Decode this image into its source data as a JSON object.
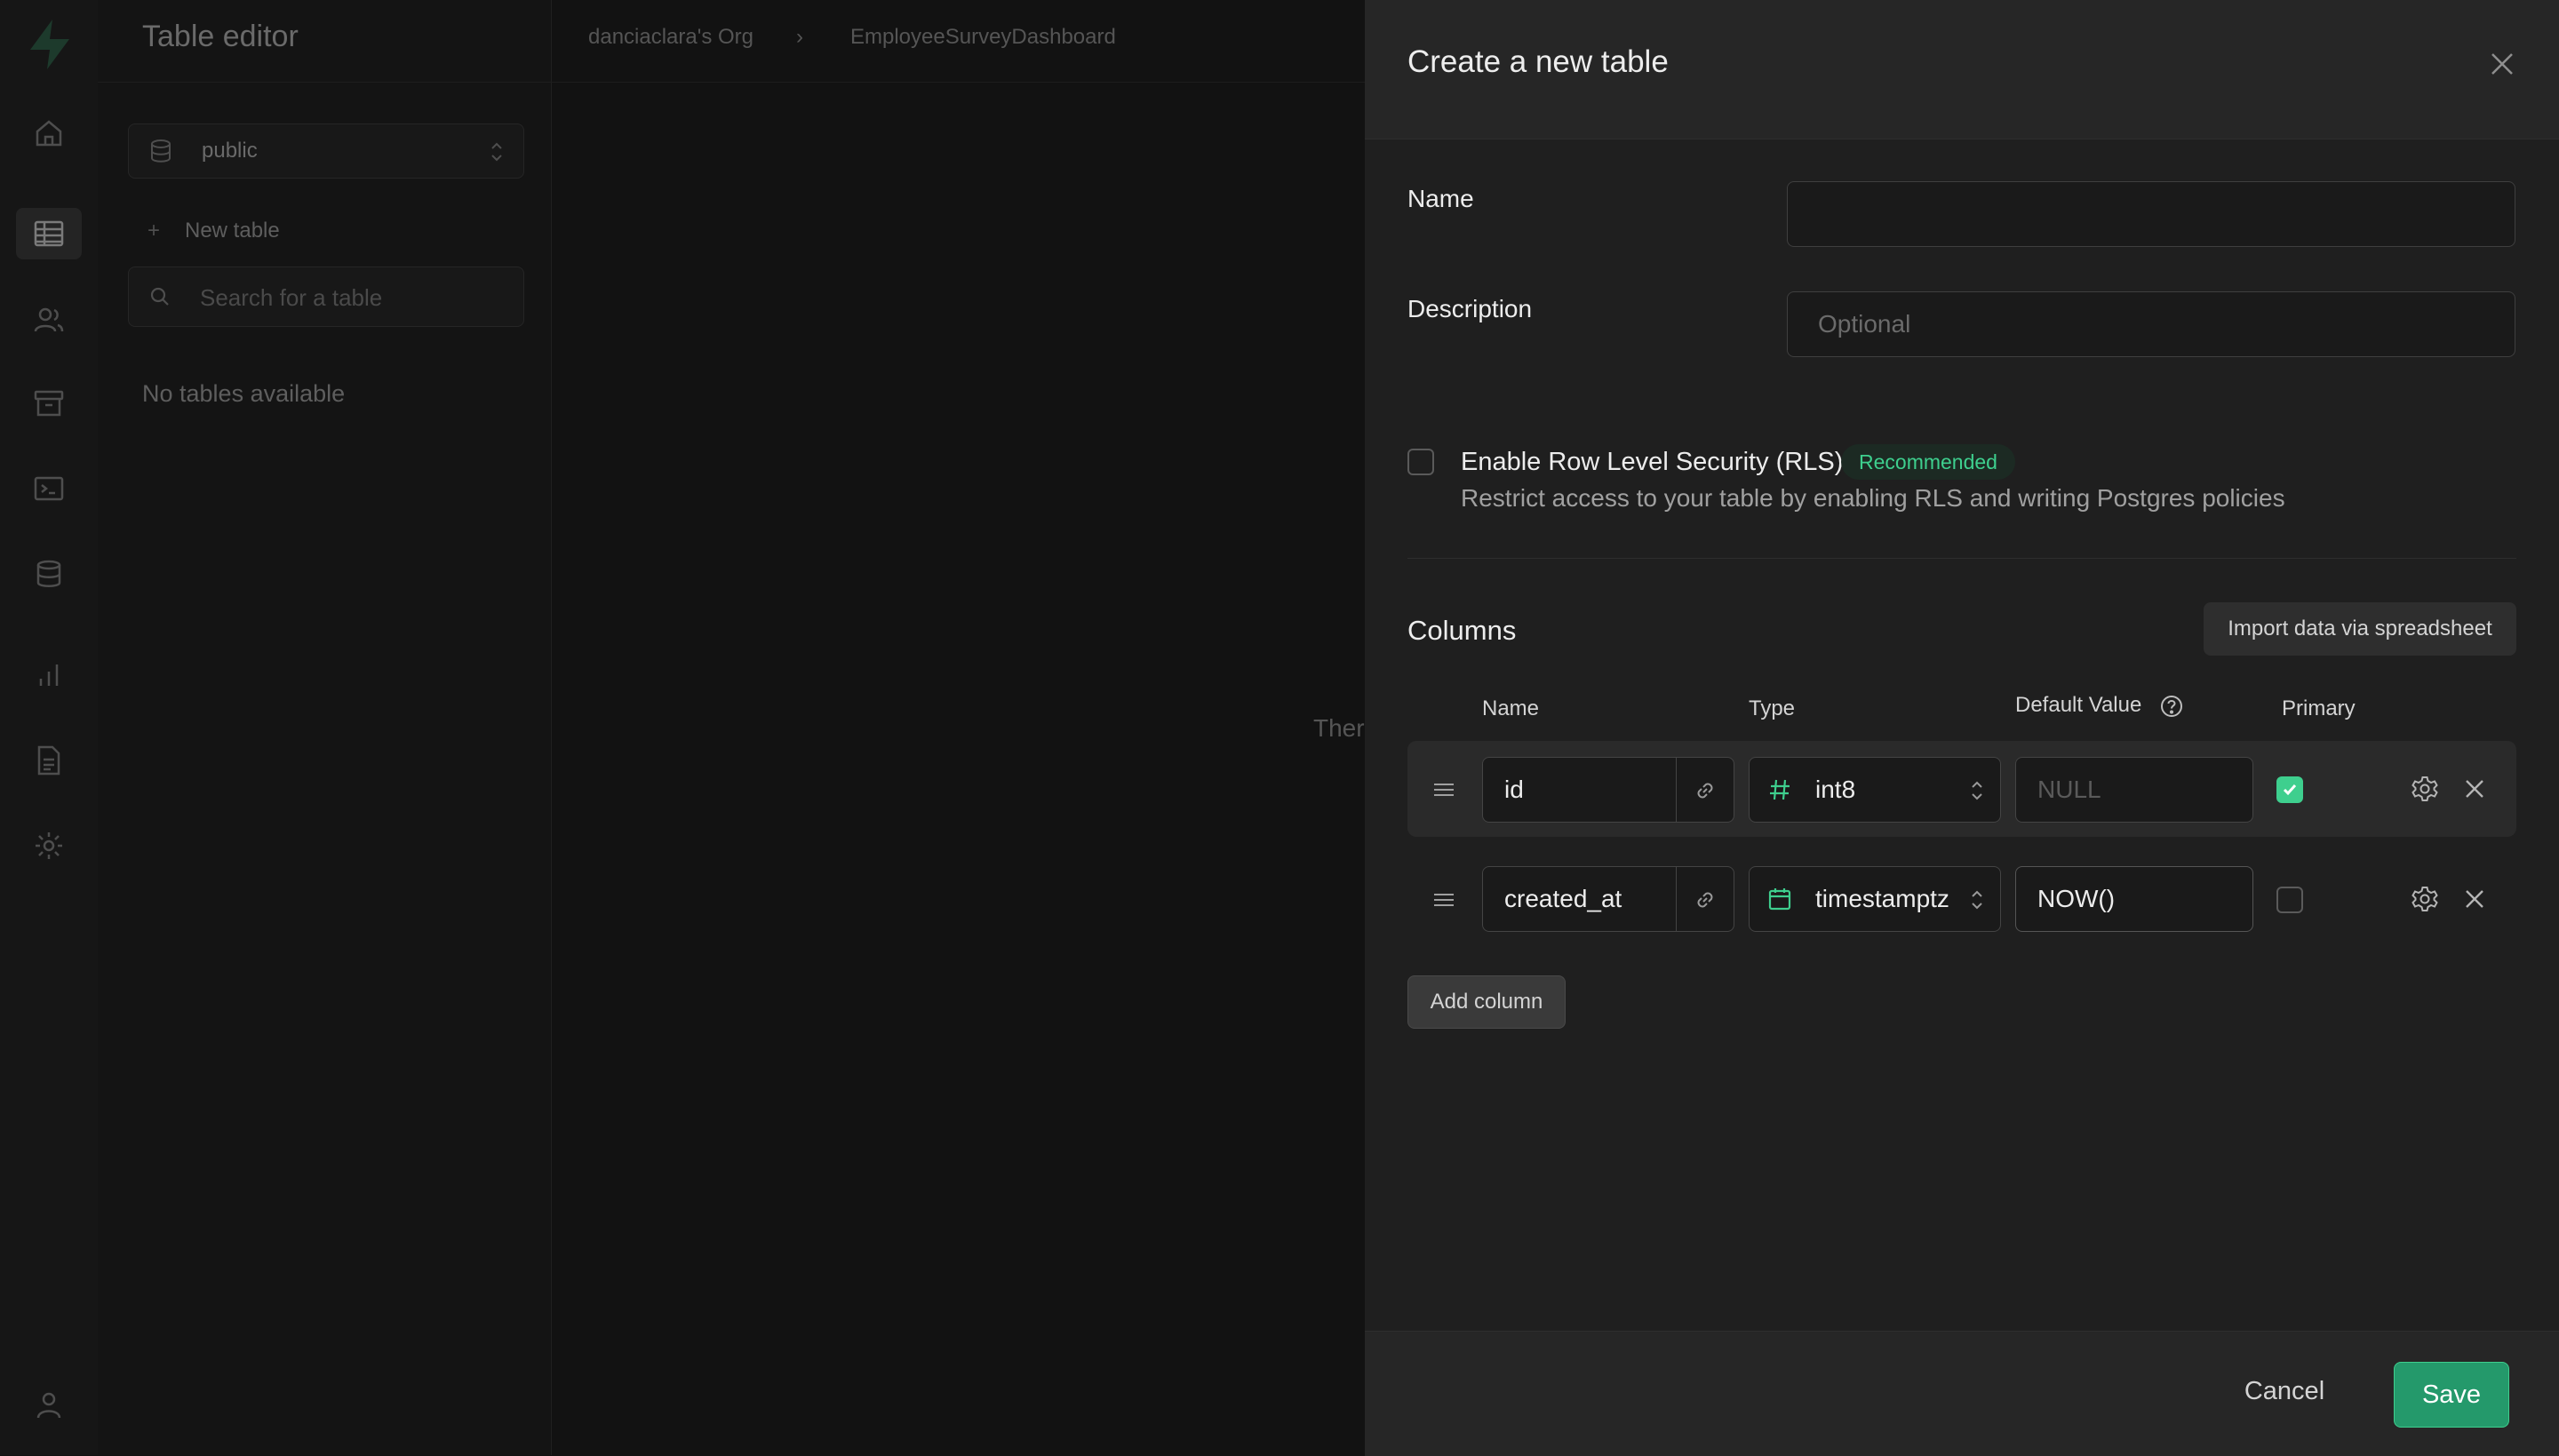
{
  "sidebar": {
    "title": "Table editor",
    "schema_label": "public",
    "new_table_label": "New table",
    "search_placeholder": "Search for a table",
    "empty_state": "No tables available"
  },
  "breadcrumb": {
    "org": "danciaclara's Org",
    "project": "EmployeeSurveyDashboard"
  },
  "background_text": "Ther",
  "rail_icons": [
    "home-icon",
    "table-editor-icon",
    "users-icon",
    "storage-icon",
    "terminal-icon",
    "database-icon",
    "reports-icon",
    "logs-icon",
    "settings-icon",
    "account-icon"
  ],
  "panel": {
    "title": "Create a new table",
    "name_label": "Name",
    "name_value": "",
    "description_label": "Description",
    "description_placeholder": "Optional",
    "rls": {
      "checked": false,
      "title": "Enable Row Level Security (RLS)",
      "badge": "Recommended",
      "description": "Restrict access to your table by enabling RLS and writing Postgres policies"
    },
    "columns_title": "Columns",
    "import_label": "Import data via spreadsheet",
    "headers": {
      "name": "Name",
      "type": "Type",
      "default": "Default Value",
      "primary": "Primary"
    },
    "rows": [
      {
        "name": "id",
        "type": "int8",
        "type_icon": "hash-icon",
        "default_value": "",
        "default_placeholder": "NULL",
        "primary": true
      },
      {
        "name": "created_at",
        "type": "timestamptz",
        "type_icon": "calendar-icon",
        "default_value": "NOW()",
        "default_placeholder": "",
        "primary": false
      }
    ],
    "add_column_label": "Add column",
    "cancel_label": "Cancel",
    "save_label": "Save"
  },
  "colors": {
    "accent": "#3ecf8e",
    "save_bg": "#24996b",
    "panel_bg": "#1f1f1f",
    "app_bg": "#121212"
  }
}
